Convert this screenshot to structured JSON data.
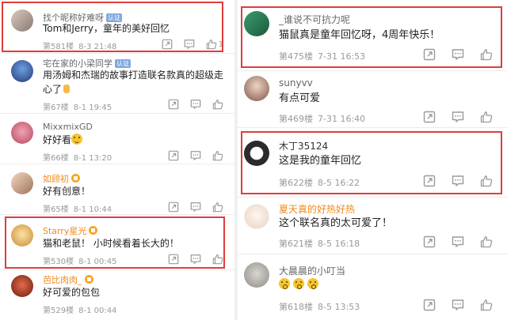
{
  "left": {
    "comments": [
      {
        "name": "找个昵称好难呀",
        "badge": "认证",
        "text": "Tom和Jerry，童年的美好回忆",
        "floor": "第581楼",
        "time": "8-3 21:48",
        "likes": "1"
      },
      {
        "name": "宅在家的小梁同学",
        "badge": "认证",
        "text_line1": "用汤姆和杰瑞的故事打造联名款真的超级走",
        "text_line2": "心了",
        "floor": "第67楼",
        "time": "8-1 19:45"
      },
      {
        "name": "MixxmixGD",
        "text": "好好看",
        "floor": "第66楼",
        "time": "8-1 13:20"
      },
      {
        "name": "如顾初",
        "text": "好有创意！",
        "floor": "第65楼",
        "time": "8-1 10:44"
      },
      {
        "name": "Starry星光",
        "text": "猫和老鼠！ 小时候看着长大的！",
        "floor": "第530楼",
        "time": "8-1 00:45"
      },
      {
        "name": "芭比肉肉_",
        "text": "好可爱的包包",
        "floor": "第529楼",
        "time": "8-1 00:44"
      }
    ]
  },
  "right": {
    "comments": [
      {
        "name": "_谁说不可抗力呢",
        "text": "猫鼠真是童年回忆呀，4周年快乐！",
        "floor": "第475楼",
        "time": "7-31 16:53"
      },
      {
        "name": "sunyvv",
        "text": "有点可爱",
        "floor": "第469楼",
        "time": "7-31 16:40"
      },
      {
        "name": "木丁35124",
        "text": "这是我的童年回忆",
        "floor": "第622楼",
        "time": "8-5 16:22"
      },
      {
        "name": "夏天真的好热好热",
        "text": "这个联名真的太可爱了！",
        "floor": "第621楼",
        "time": "8-5 16:18"
      },
      {
        "name": "大晨晨的小叮当",
        "floor": "第618楼",
        "time": "8-5 13:53"
      }
    ]
  },
  "colors": {
    "highlight": "#e03c3c",
    "meta": "#9a9a9a",
    "orange_name": "#f08a1c",
    "badge": "#7fa8e0"
  },
  "icons": [
    "share-icon",
    "comment-icon",
    "like-icon"
  ]
}
